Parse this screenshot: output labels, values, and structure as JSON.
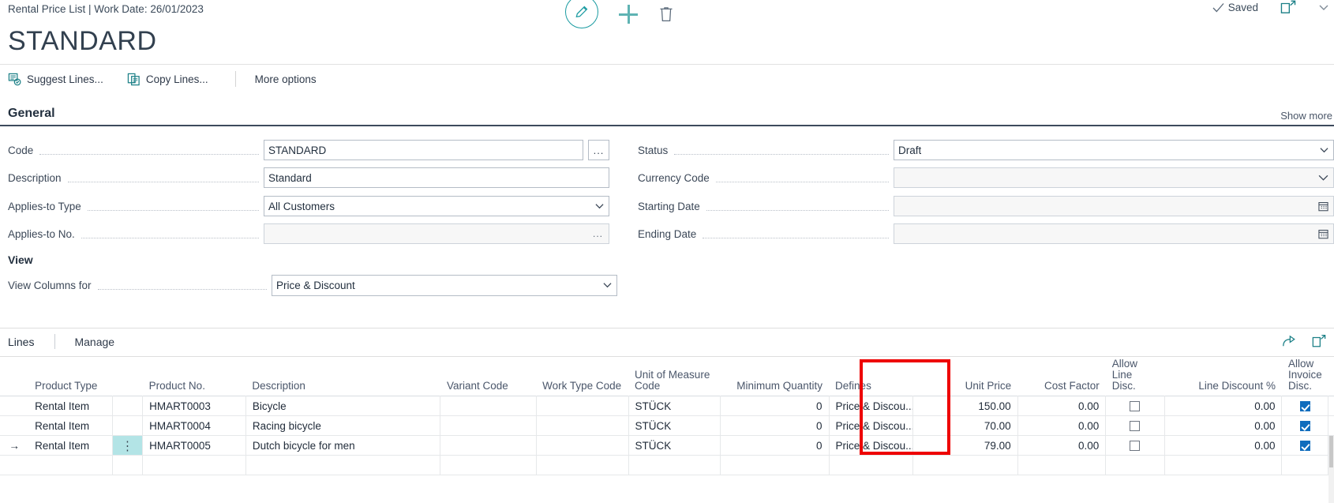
{
  "topbar": {
    "breadcrumb": "Rental Price List | Work Date: 26/01/2023",
    "edit_icon": "pencil-icon",
    "new_icon": "plus-icon",
    "delete_icon": "trash-icon",
    "saved_label": "Saved",
    "saved_check_icon": "check-icon",
    "open_in_new_icon": "open-in-new-window-icon",
    "chevron_icon": "chevron-icon"
  },
  "page_title": "STANDARD",
  "ribbon": {
    "suggest_lines": "Suggest Lines...",
    "suggest_lines_icon": "suggest-lines-icon",
    "copy_lines": "Copy Lines...",
    "copy_lines_icon": "copy-lines-icon",
    "more_options": "More options"
  },
  "general": {
    "heading": "General",
    "show_more": "Show more",
    "left_fields": [
      {
        "label": "Code",
        "value": "STANDARD",
        "control": "text-with-lookup-button"
      },
      {
        "label": "Description",
        "value": "Standard",
        "control": "text"
      },
      {
        "label": "Applies-to Type",
        "value": "All Customers",
        "control": "select"
      },
      {
        "label": "Applies-to No.",
        "value": "",
        "control": "text-with-inline-ellipsis"
      }
    ],
    "right_fields": [
      {
        "label": "Status",
        "value": "Draft",
        "control": "select"
      },
      {
        "label": "Currency Code",
        "value": "",
        "control": "select-readonly"
      },
      {
        "label": "Starting Date",
        "value": "",
        "control": "date"
      },
      {
        "label": "Ending Date",
        "value": "",
        "control": "date"
      }
    ],
    "lookup_button_label": "...",
    "inline_ellipsis_label": "..."
  },
  "view": {
    "heading": "View",
    "field": {
      "label": "View Columns for",
      "value": "Price & Discount",
      "control": "select"
    }
  },
  "lines": {
    "tab_title": "Lines",
    "tab_manage": "Manage",
    "share_icon": "share-icon",
    "open_in_excel_icon": "open-in-new-window-icon",
    "columns": [
      "Product Type",
      "Product No.",
      "Description",
      "Variant Code",
      "Work Type Code",
      "Unit of Measure Code",
      "Minimum Quantity",
      "Defines",
      "Unit Price",
      "Cost Factor",
      "Allow Line Disc.",
      "Line Discount %",
      "Allow Invoice Disc."
    ],
    "rows": [
      {
        "selected": false,
        "arrow": "",
        "product_type": "Rental Item",
        "product_no": "HMART0003",
        "description": "Bicycle",
        "variant_code": "",
        "work_type_code": "",
        "unit_of_measure_code": "STÜCK",
        "minimum_quantity": "0",
        "defines": "Price & Discou...",
        "unit_price": "150.00",
        "cost_factor": "0.00",
        "allow_line_disc": false,
        "line_discount_pct": "0.00",
        "allow_invoice_disc": true
      },
      {
        "selected": false,
        "arrow": "",
        "product_type": "Rental Item",
        "product_no": "HMART0004",
        "description": "Racing bicycle",
        "variant_code": "",
        "work_type_code": "",
        "unit_of_measure_code": "STÜCK",
        "minimum_quantity": "0",
        "defines": "Price & Discou...",
        "unit_price": "70.00",
        "cost_factor": "0.00",
        "allow_line_disc": false,
        "line_discount_pct": "0.00",
        "allow_invoice_disc": true
      },
      {
        "selected": true,
        "arrow": "→",
        "product_type": "Rental Item",
        "product_no": "HMART0005",
        "description": "Dutch bicycle for men",
        "variant_code": "",
        "work_type_code": "",
        "unit_of_measure_code": "STÜCK",
        "minimum_quantity": "0",
        "defines": "Price & Discou...",
        "unit_price": "79.00",
        "cost_factor": "0.00",
        "allow_line_disc": false,
        "line_discount_pct": "0.00",
        "allow_invoice_disc": true
      },
      {
        "selected": false,
        "arrow": "",
        "product_type": "",
        "product_no": "",
        "description": "",
        "variant_code": "",
        "work_type_code": "",
        "unit_of_measure_code": "",
        "minimum_quantity": "",
        "defines": "",
        "unit_price": "",
        "cost_factor": "",
        "allow_line_disc": null,
        "line_discount_pct": "",
        "allow_invoice_disc": null
      }
    ],
    "row_menu_icon": "vertical-ellipsis-icon",
    "row_menu_glyph": "⋮",
    "highlight": {
      "column": "Unit Price",
      "color": "#ee0000"
    }
  },
  "colors": {
    "accent_teal": "#1a9ba1",
    "plus_teal": "#5fb3b3",
    "rule_dark": "#3d4a5c",
    "selection_cyan": "#b3e4e6",
    "checkbox_blue": "#0f6cbd",
    "highlight_red": "#ee0000"
  }
}
